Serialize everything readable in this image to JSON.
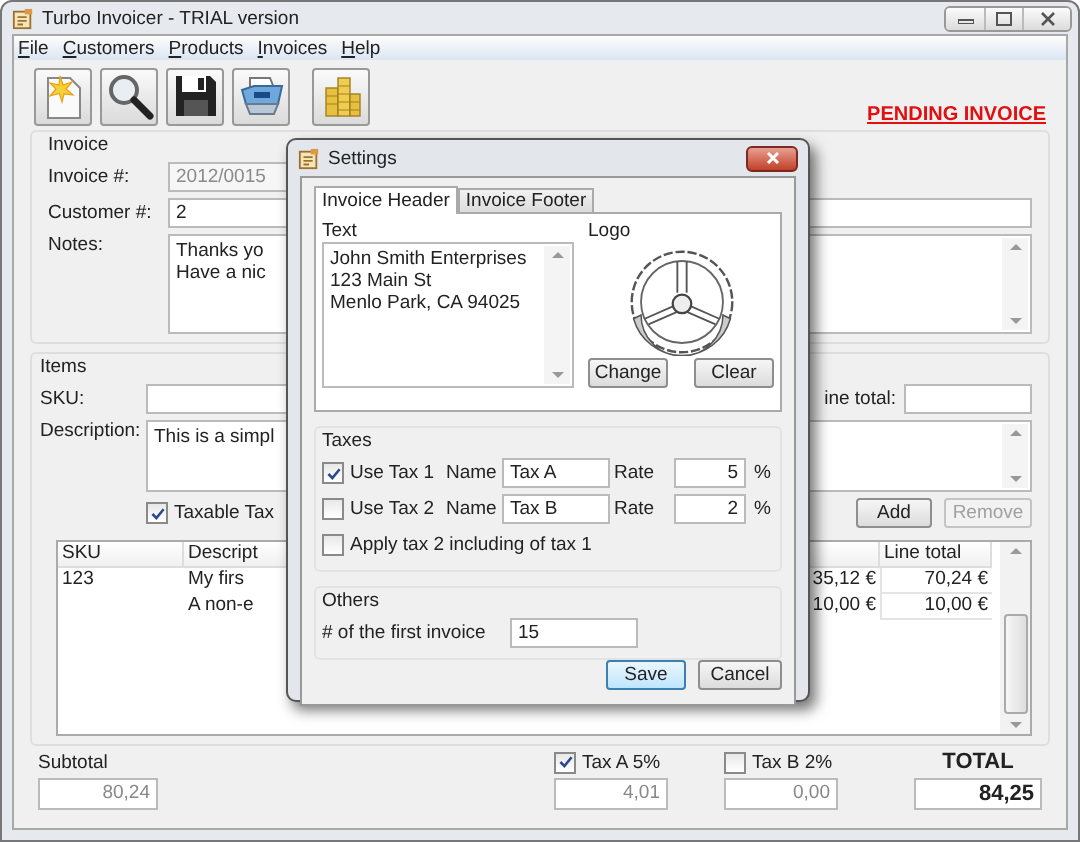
{
  "window": {
    "title": "Turbo Invoicer - TRIAL version"
  },
  "menu": [
    "File",
    "Customers",
    "Products",
    "Invoices",
    "Help"
  ],
  "status_banner": "PENDING INVOICE",
  "invoice": {
    "title": "Invoice",
    "fields": [
      {
        "label": "Invoice #:",
        "value": "2012/0015",
        "disabled": true
      },
      {
        "label": "Customer #:",
        "value": "2",
        "disabled": false
      }
    ],
    "notes": {
      "label": "Notes:",
      "lines": [
        "Thanks yo",
        "Have a nic"
      ]
    }
  },
  "items": {
    "title": "Items",
    "sku_label": "SKU:",
    "line_total_label": "ine total:",
    "description_label": "Description:",
    "description_value": "This is a simpl",
    "taxable": {
      "label": "Taxable Tax",
      "checked": true
    },
    "buttons": [
      {
        "label": "Add",
        "disabled": false
      },
      {
        "label": "Remove",
        "disabled": true
      }
    ],
    "table": {
      "columns": {
        "sku": "SKU",
        "description": "Descript",
        "line_total": "Line total"
      },
      "rows": [
        {
          "sku": "123",
          "description": "My firs",
          "column_3": "35,12 €",
          "line_total": "70,24 €"
        },
        {
          "description": "A non-e",
          "column_3": "10,00 €",
          "line_total": "10,00 €"
        }
      ]
    }
  },
  "totals": {
    "subtotal": {
      "label": "Subtotal",
      "value": "80,24"
    },
    "taxes": [
      {
        "label": "Tax A 5%",
        "checked": true,
        "value": "4,01"
      },
      {
        "label": "Tax B 2%",
        "checked": false,
        "value": "0,00"
      }
    ],
    "total": {
      "label": "TOTAL",
      "value": "84,25"
    }
  },
  "dialog": {
    "title": "Settings",
    "tabs": [
      {
        "label": "Invoice Header",
        "selected": true
      },
      {
        "label": "Invoice Footer",
        "selected": false
      }
    ],
    "text_label": "Text",
    "header_text": [
      "John Smith Enterprises",
      "123 Main St",
      "Menlo Park, CA 94025"
    ],
    "logo_label": "Logo",
    "logo_buttons": [
      "Change",
      "Clear"
    ],
    "taxes": {
      "title": "Taxes",
      "rows": [
        {
          "label": "Use Tax 1",
          "checked": true,
          "name_label": "Name",
          "name": "Tax A",
          "rate_label": "Rate",
          "rate": "5",
          "unit": "%"
        },
        {
          "label": "Use Tax 2",
          "checked": false,
          "name_label": "Name",
          "name": "Tax B",
          "rate_label": "Rate",
          "rate": "2",
          "unit": "%"
        }
      ],
      "apply": {
        "label": "Apply tax 2 including of tax 1",
        "checked": false
      }
    },
    "others": {
      "title": "Others",
      "label": "# of the first invoice",
      "value": "15"
    },
    "buttons": [
      {
        "label": "Save",
        "default": true
      },
      {
        "label": "Cancel",
        "default": false
      }
    ]
  }
}
